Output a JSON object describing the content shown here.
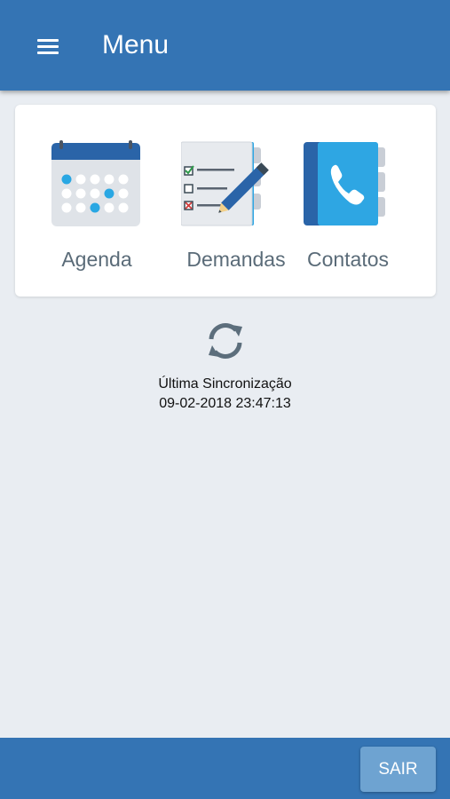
{
  "header": {
    "menu_icon": "hamburger-menu-icon",
    "title": "Menu"
  },
  "menu": {
    "items": [
      {
        "label": "Agenda",
        "icon": "calendar-icon"
      },
      {
        "label": "Demandas",
        "icon": "checklist-icon"
      },
      {
        "label": "Contatos",
        "icon": "phonebook-icon"
      }
    ]
  },
  "sync": {
    "icon": "sync-icon",
    "label": "Última Sincronização",
    "timestamp": "09-02-2018 23:47:13"
  },
  "footer": {
    "exit_label": "SAIR"
  },
  "colors": {
    "primary": "#3474b4",
    "background": "#e9edf2",
    "button": "#6ea3d1",
    "accent": "#2ba9e6"
  }
}
